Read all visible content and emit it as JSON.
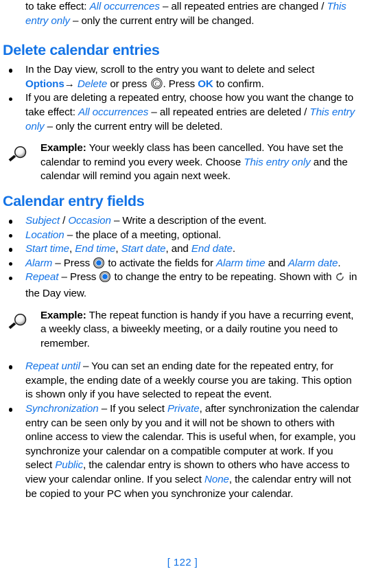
{
  "document": {
    "page_number": "[ 122 ]",
    "accent_color": "#1373e6",
    "text_color": "#000000"
  },
  "top_paragraph": {
    "t1": "to take effect: ",
    "em1": "All occurrences",
    "t2": " – all repeated entries are changed / ",
    "em2": "This entry only",
    "t3": " – only the current entry will be changed."
  },
  "sections": [
    {
      "heading": "Delete calendar entries",
      "bullets": [
        {
          "t1": "In the Day view, scroll to the entry you want to delete and select ",
          "strong1": "Options",
          "arrow": "→",
          "em1": "Delete",
          "t2": " or press ",
          "icon1": "clear-key-icon",
          "t3": ". Press ",
          "strong2": "OK",
          "t4": " to confirm."
        },
        {
          "t1": "If you are deleting a repeated entry, choose how you want the change to take effect: ",
          "em1": "All occurrences",
          "t2": " – all repeated entries are deleted / ",
          "em2": "This entry only",
          "t3": " – only the current entry will be deleted."
        }
      ],
      "note": {
        "icon": "magnifier-icon",
        "label": "Example:",
        "t1": " Your weekly class has been cancelled. You have set the calendar to remind you every week. Choose ",
        "em1": "This entry only",
        "t2": " and the calendar will remind you again next week."
      }
    },
    {
      "heading": "Calendar entry fields"
    }
  ],
  "entry_fields": {
    "b1": {
      "em1": "Subject",
      "sep": " / ",
      "em2": "Occasion",
      "t1": " – Write a description of the event."
    },
    "b2": {
      "em1": "Location",
      "t1": " – the place of a meeting, optional."
    },
    "b3": {
      "em1": "Start time",
      "s1": ", ",
      "em2": "End time",
      "s2": ", ",
      "em3": "Start date",
      "s3": ", and ",
      "em4": "End date",
      "s4": "."
    },
    "b4": {
      "em1": "Alarm",
      "t1": " – Press ",
      "icon": "scroll-key-icon",
      "t2": " to activate the fields for ",
      "em2": "Alarm time",
      "t3": " and ",
      "em3": "Alarm date",
      "t4": "."
    },
    "b5": {
      "em1": "Repeat",
      "t1": " – Press ",
      "icon": "scroll-key-icon",
      "t2": " to change the entry to be repeating. Shown with ",
      "icon2": "repeat-arrow-icon",
      "t3": " in the Day view."
    },
    "b6": {
      "em1": "Repeat until",
      "t1": " – You can set an ending date for the repeated entry, for example, the ending date of a weekly course you are taking. This option is shown only if you have selected to repeat the event."
    },
    "b7": {
      "em1": "Synchronization",
      "t1": " – If you select ",
      "em2": "Private",
      "t2": ", after synchronization the calendar entry can be seen only by you and it will not be shown to others with online access to view the calendar. This is useful when, for example, you synchronize your calendar on a compatible computer at work. If you select ",
      "em3": "Public",
      "t3": ", the calendar entry is shown to others who have access to view your calendar online. If you select ",
      "em4": "None",
      "t4": ", the calendar entry will not be copied to your PC when you synchronize your calendar."
    }
  },
  "repeat_note": {
    "icon": "magnifier-icon",
    "label": "Example:",
    "t1": " The repeat function is handy if you have a recurring event, a weekly class, a biweekly meeting, or a daily routine you need to remember."
  }
}
